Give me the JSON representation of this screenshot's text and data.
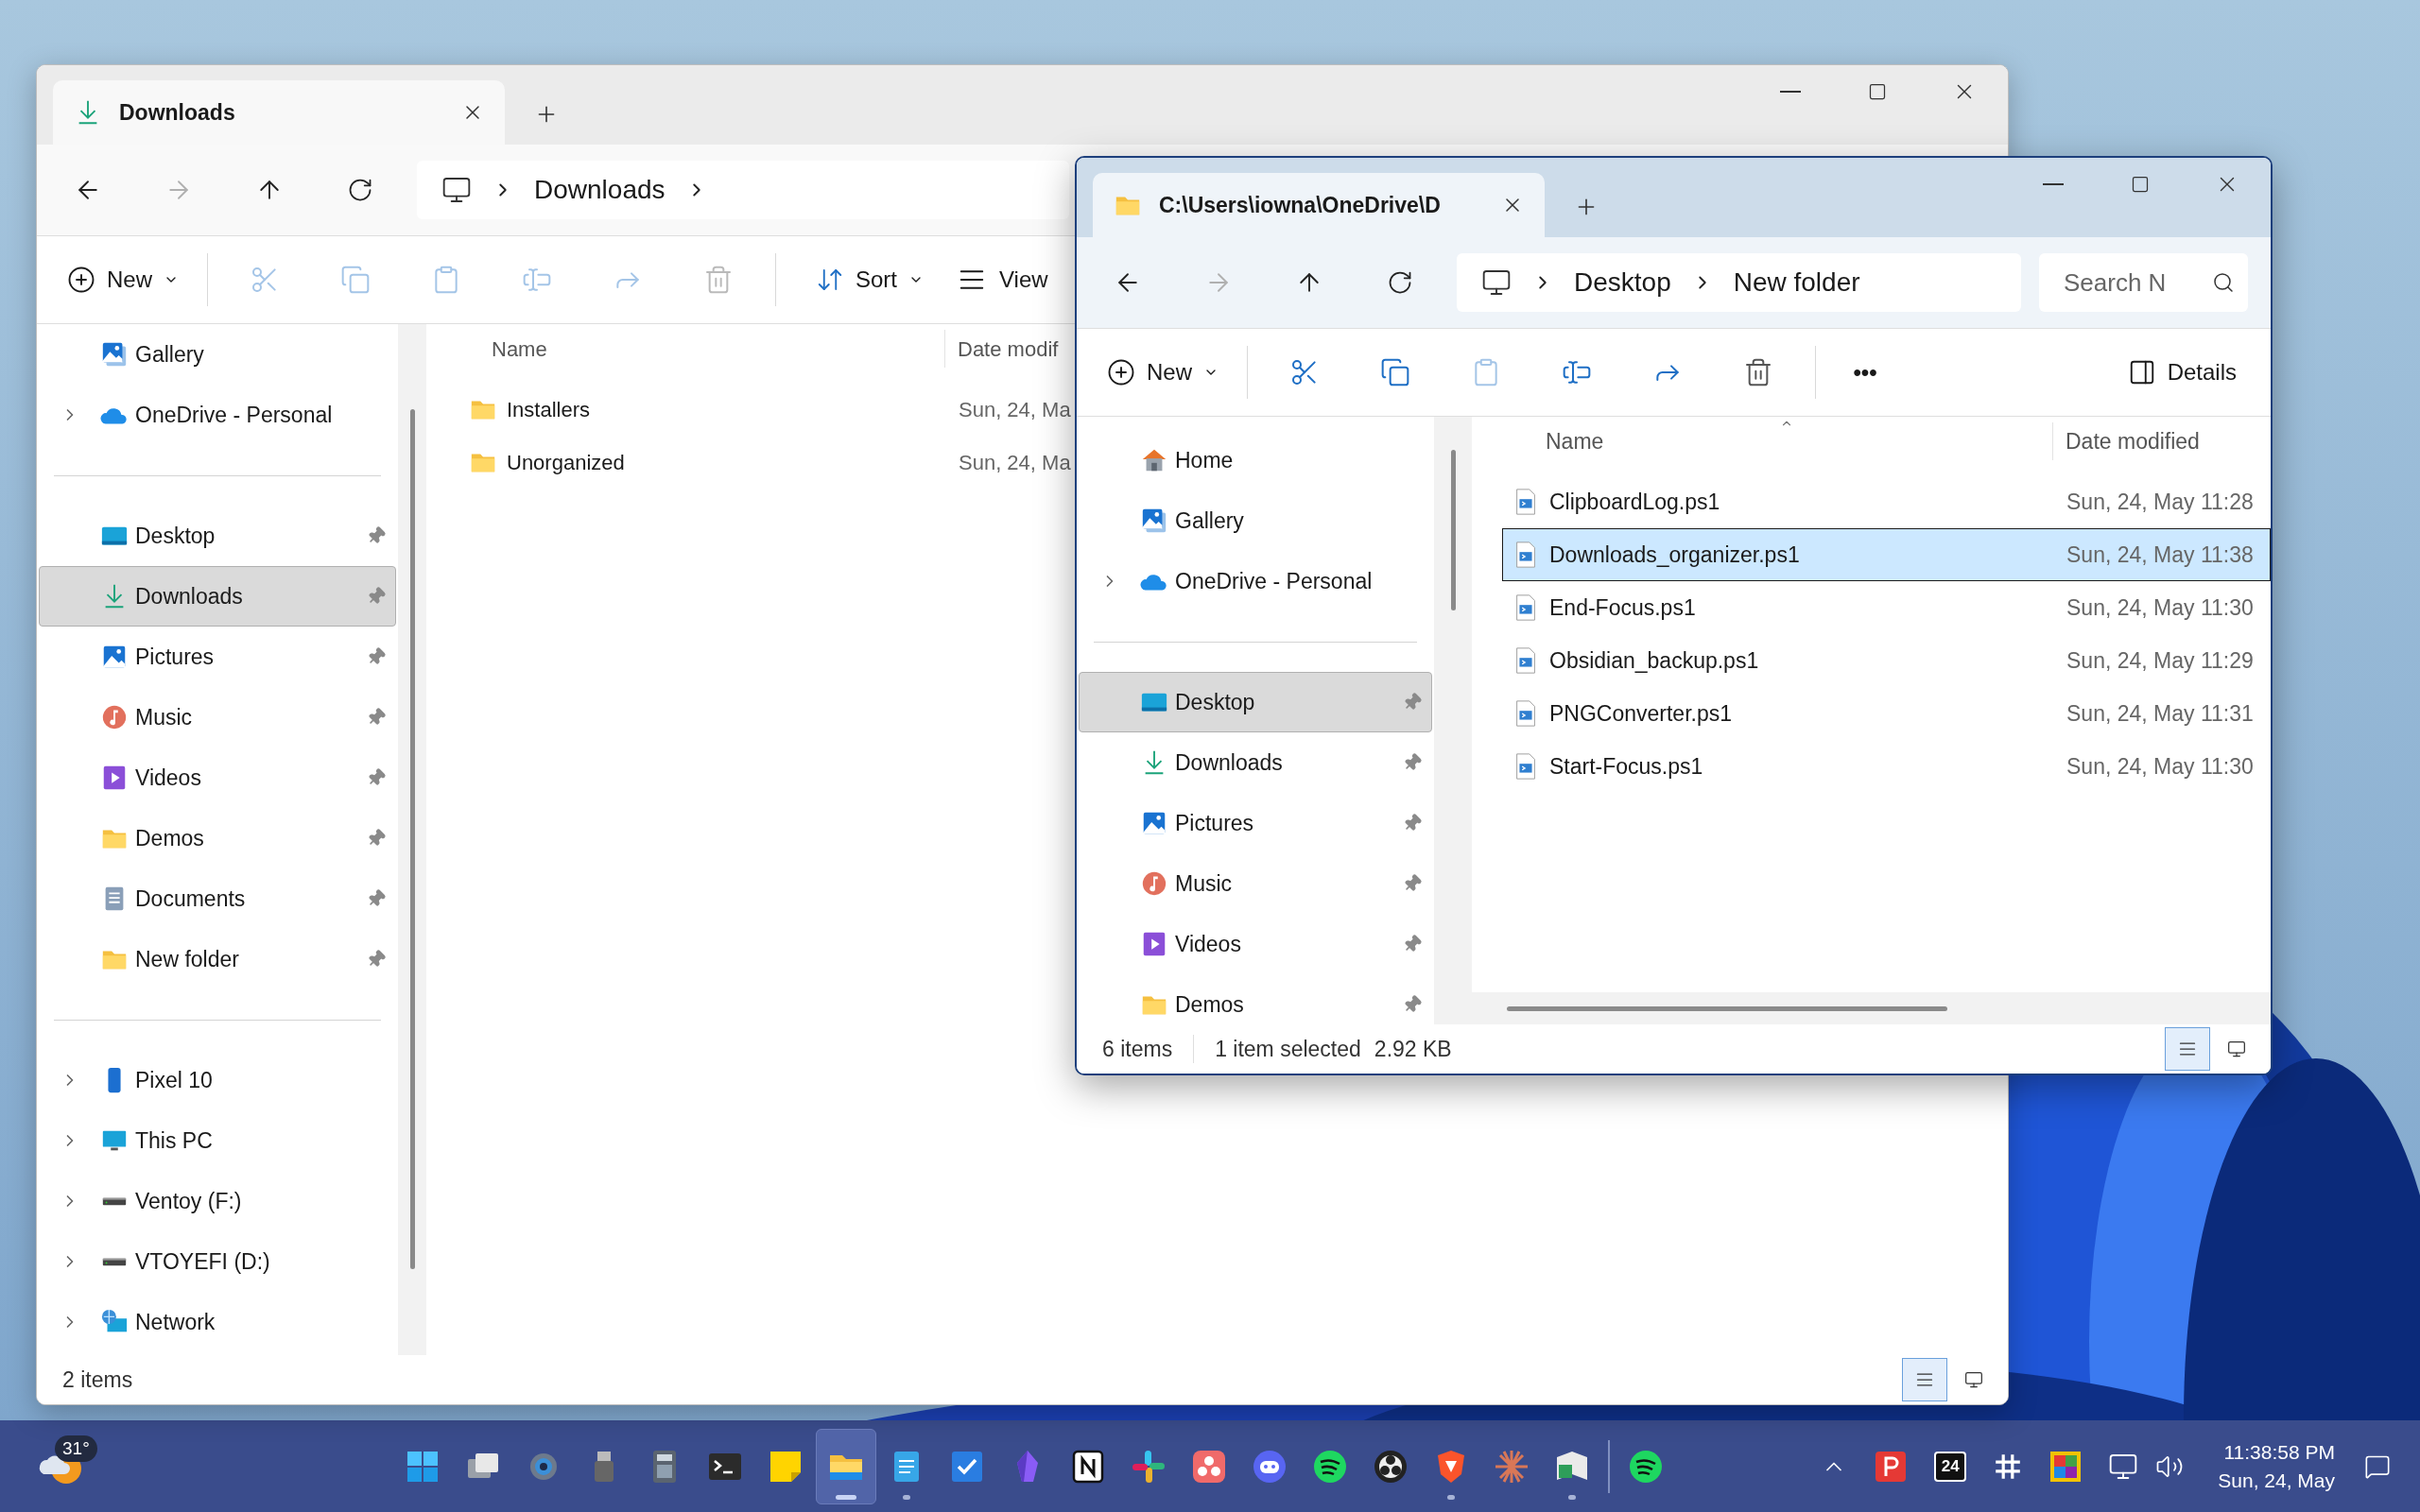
{
  "windows": [
    {
      "active": false,
      "tab": {
        "kind": "downloads",
        "title": "Downloads"
      },
      "breadcrumbs": [
        "Downloads"
      ],
      "trailing_chevron": true,
      "sort_indicator": false,
      "commands": [
        {
          "kind": "new",
          "label": "New",
          "disabled": false
        },
        {
          "kind": "separator"
        },
        {
          "kind": "cut",
          "disabled": true
        },
        {
          "kind": "copy",
          "disabled": true
        },
        {
          "kind": "paste",
          "disabled": true
        },
        {
          "kind": "rename",
          "disabled": true
        },
        {
          "kind": "share",
          "disabled": true
        },
        {
          "kind": "delete",
          "disabled": true
        },
        {
          "kind": "separator"
        },
        {
          "kind": "sort",
          "label": "Sort",
          "disabled": false
        },
        {
          "kind": "view",
          "label": "View",
          "disabled": false
        }
      ],
      "sidebar": [
        {
          "items": [
            {
              "kind": "gallery",
              "label": "Gallery",
              "expandable": false,
              "pinned": false,
              "selected": false
            },
            {
              "kind": "onedrive",
              "label": "OneDrive - Personal",
              "expandable": true,
              "pinned": false,
              "selected": false
            }
          ]
        },
        {
          "items": [
            {
              "kind": "desktop",
              "label": "Desktop",
              "expandable": false,
              "pinned": true,
              "selected": false
            },
            {
              "kind": "downloads",
              "label": "Downloads",
              "expandable": false,
              "pinned": true,
              "selected": true
            },
            {
              "kind": "pictures",
              "label": "Pictures",
              "expandable": false,
              "pinned": true,
              "selected": false
            },
            {
              "kind": "music",
              "label": "Music",
              "expandable": false,
              "pinned": true,
              "selected": false
            },
            {
              "kind": "videos",
              "label": "Videos",
              "expandable": false,
              "pinned": true,
              "selected": false
            },
            {
              "kind": "folder",
              "label": "Demos",
              "expandable": false,
              "pinned": true,
              "selected": false
            },
            {
              "kind": "documents",
              "label": "Documents",
              "expandable": false,
              "pinned": true,
              "selected": false
            },
            {
              "kind": "folder",
              "label": "New folder",
              "expandable": false,
              "pinned": true,
              "selected": false
            }
          ]
        },
        {
          "items": [
            {
              "kind": "phone",
              "label": "Pixel 10",
              "expandable": true,
              "pinned": false,
              "selected": false
            },
            {
              "kind": "pc",
              "label": "This PC",
              "expandable": true,
              "pinned": false,
              "selected": false
            },
            {
              "kind": "drive",
              "label": "Ventoy (F:)",
              "expandable": true,
              "pinned": false,
              "selected": false
            },
            {
              "kind": "drive",
              "label": "VTOYEFI (D:)",
              "expandable": true,
              "pinned": false,
              "selected": false
            },
            {
              "kind": "network",
              "label": "Network",
              "expandable": true,
              "pinned": false,
              "selected": false
            }
          ]
        }
      ],
      "columns": [
        "Name",
        "Date modif"
      ],
      "rows": [
        {
          "kind": "folder",
          "name": "Installers",
          "date": "Sun, 24, Ma",
          "selected": false
        },
        {
          "kind": "folder",
          "name": "Unorganized",
          "date": "Sun, 24, Ma",
          "selected": false
        }
      ],
      "status": [
        "2 items"
      ],
      "view_modes": [
        {
          "kind": "details",
          "selected": true
        },
        {
          "kind": "tiles",
          "selected": false
        }
      ]
    },
    {
      "active": true,
      "tab": {
        "kind": "folder",
        "title": "C:\\Users\\iowna\\OneDrive\\D"
      },
      "breadcrumbs": [
        "Desktop",
        "New folder"
      ],
      "trailing_chevron": false,
      "sort_indicator": true,
      "search": {
        "placeholder": "Search N"
      },
      "commands": [
        {
          "kind": "new",
          "label": "New",
          "disabled": false
        },
        {
          "kind": "separator"
        },
        {
          "kind": "cut",
          "disabled": false
        },
        {
          "kind": "copy",
          "disabled": false
        },
        {
          "kind": "paste",
          "disabled": true
        },
        {
          "kind": "rename",
          "disabled": false
        },
        {
          "kind": "share",
          "disabled": false
        },
        {
          "kind": "delete",
          "disabled": false
        },
        {
          "kind": "separator"
        },
        {
          "kind": "more",
          "label": "•••",
          "disabled": false
        },
        {
          "kind": "details",
          "label": "Details",
          "disabled": false
        }
      ],
      "sidebar": [
        {
          "items": [
            {
              "kind": "home",
              "label": "Home",
              "expandable": false,
              "pinned": false,
              "selected": false
            },
            {
              "kind": "gallery",
              "label": "Gallery",
              "expandable": false,
              "pinned": false,
              "selected": false
            },
            {
              "kind": "onedrive",
              "label": "OneDrive - Personal",
              "expandable": true,
              "pinned": false,
              "selected": false
            }
          ]
        },
        {
          "items": [
            {
              "kind": "desktop",
              "label": "Desktop",
              "expandable": false,
              "pinned": true,
              "selected": true
            },
            {
              "kind": "downloads",
              "label": "Downloads",
              "expandable": false,
              "pinned": true,
              "selected": false
            },
            {
              "kind": "pictures",
              "label": "Pictures",
              "expandable": false,
              "pinned": true,
              "selected": false
            },
            {
              "kind": "music",
              "label": "Music",
              "expandable": false,
              "pinned": true,
              "selected": false
            },
            {
              "kind": "videos",
              "label": "Videos",
              "expandable": false,
              "pinned": true,
              "selected": false
            },
            {
              "kind": "folder",
              "label": "Demos",
              "expandable": false,
              "pinned": true,
              "selected": false
            }
          ]
        }
      ],
      "columns": [
        "Name",
        "Date modified"
      ],
      "rows": [
        {
          "kind": "script",
          "name": "ClipboardLog.ps1",
          "date": "Sun, 24, May 11:28",
          "selected": false
        },
        {
          "kind": "script",
          "name": "Downloads_organizer.ps1",
          "date": "Sun, 24, May 11:38",
          "selected": true
        },
        {
          "kind": "script",
          "name": "End-Focus.ps1",
          "date": "Sun, 24, May 11:30",
          "selected": false
        },
        {
          "kind": "script",
          "name": "Obsidian_backup.ps1",
          "date": "Sun, 24, May 11:29",
          "selected": false
        },
        {
          "kind": "script",
          "name": "PNGConverter.ps1",
          "date": "Sun, 24, May 11:31",
          "selected": false
        },
        {
          "kind": "script",
          "name": "Start-Focus.ps1",
          "date": "Sun, 24, May 11:30",
          "selected": false
        }
      ],
      "status": [
        "6 items",
        "1 item selected",
        "2.92 KB"
      ],
      "view_modes": [
        {
          "kind": "details",
          "selected": true
        },
        {
          "kind": "tiles",
          "selected": false
        }
      ]
    }
  ],
  "taskbar": {
    "weather": {
      "temperature": "31°"
    },
    "apps": [
      {
        "kind": "start",
        "running": false,
        "active": false
      },
      {
        "kind": "taskview",
        "running": false,
        "active": false
      },
      {
        "kind": "settings",
        "running": false,
        "active": false
      },
      {
        "kind": "usb",
        "running": false,
        "active": false
      },
      {
        "kind": "calculator",
        "running": false,
        "active": false
      },
      {
        "kind": "terminal",
        "running": false,
        "active": false
      },
      {
        "kind": "sticky",
        "running": false,
        "active": false
      },
      {
        "kind": "explorer",
        "running": true,
        "active": true
      },
      {
        "kind": "notepad",
        "running": true,
        "active": false
      },
      {
        "kind": "todo",
        "running": false,
        "active": false
      },
      {
        "kind": "crystal",
        "running": false,
        "active": false
      },
      {
        "kind": "notebook",
        "running": false,
        "active": false
      },
      {
        "kind": "hash",
        "running": false,
        "active": false
      },
      {
        "kind": "dots",
        "running": false,
        "active": false
      },
      {
        "kind": "chat",
        "running": false,
        "active": false
      },
      {
        "kind": "wave",
        "running": false,
        "active": false
      },
      {
        "kind": "aperture",
        "running": false,
        "active": false
      },
      {
        "kind": "shield",
        "running": true,
        "active": false
      },
      {
        "kind": "starburst",
        "running": false,
        "active": false
      },
      {
        "kind": "book",
        "running": true,
        "active": false
      },
      {
        "kind": "separator"
      },
      {
        "kind": "wave",
        "running": false,
        "active": false
      }
    ],
    "tray": [
      {
        "kind": "chevron"
      },
      {
        "kind": "redapp"
      },
      {
        "kind": "calendar",
        "label": "24"
      },
      {
        "kind": "hash"
      },
      {
        "kind": "colorful"
      },
      {
        "kind": "quick"
      }
    ],
    "time": "11:38:58 PM",
    "date": "Sun, 24, May"
  }
}
